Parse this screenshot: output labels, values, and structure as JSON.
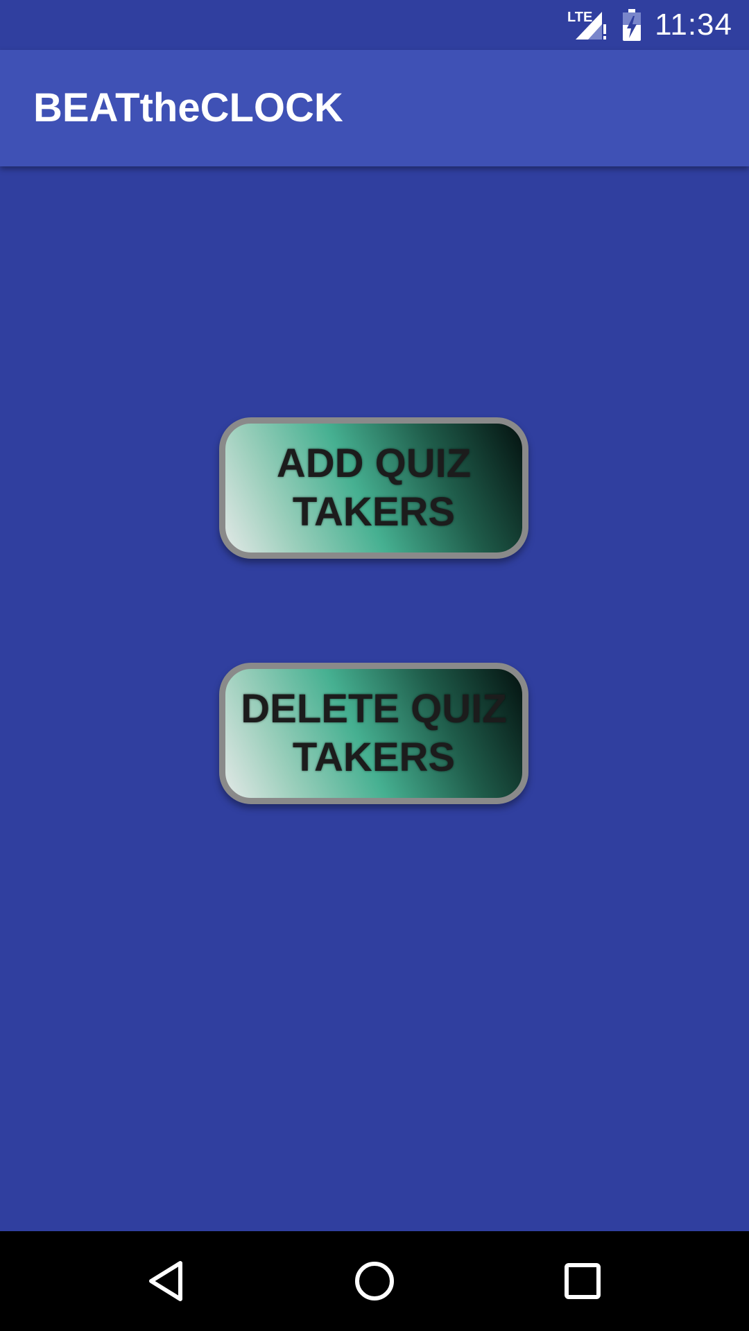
{
  "status_bar": {
    "time": "11:34",
    "network_label": "LTE",
    "icons": [
      "lte-signal-icon",
      "battery-charging-icon"
    ]
  },
  "app_bar": {
    "title": "BEATtheCLOCK"
  },
  "main": {
    "buttons": [
      {
        "label": "ADD QUIZ\nTAKERS"
      },
      {
        "label": "DELETE QUIZ\nTAKERS"
      }
    ]
  },
  "nav_bar": {
    "icons": [
      "back-icon",
      "home-icon",
      "recents-icon"
    ]
  },
  "colors": {
    "status_bar": "#303f9f",
    "app_bar": "#3f51b5",
    "background": "#303f9f",
    "nav_bar": "#000000",
    "button_border": "#8a8a8a",
    "button_text": "#1c1c1c"
  }
}
